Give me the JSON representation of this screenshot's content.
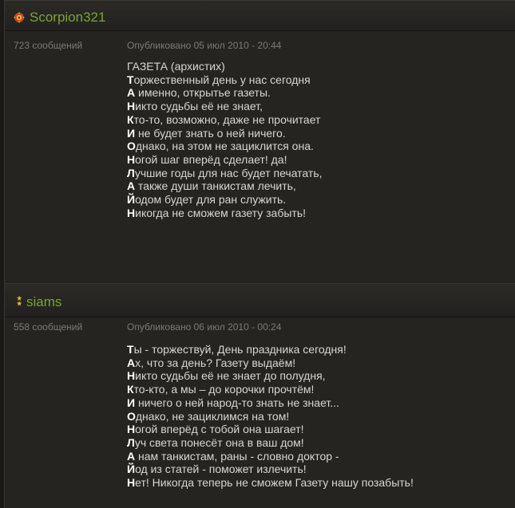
{
  "posts": [
    {
      "author": "Scorpion321",
      "message_count": "723 сообщений",
      "published": "Опубликовано 05 июл 2010 - 20:44",
      "icon": "gear-flower-icon",
      "lines": [
        {
          "cap": "",
          "rest": "ГАЗЕТА (архистих)"
        },
        {
          "cap": "Т",
          "rest": "оржественный день у нас сегодня"
        },
        {
          "cap": "А",
          "rest": " именно, открытье газеты."
        },
        {
          "cap": "Н",
          "rest": "икто судьбы её не знает,"
        },
        {
          "cap": "К",
          "rest": "то-то, возможно, даже не прочитает"
        },
        {
          "cap": "И",
          "rest": " не будет знать о ней ничего."
        },
        {
          "cap": "О",
          "rest": "днако, на этом не зациклится она."
        },
        {
          "cap": "Н",
          "rest": "огой шаг вперёд сделает! да!"
        },
        {
          "cap": "Л",
          "rest": "учшие годы для нас будет печатать,"
        },
        {
          "cap": "А",
          "rest": " также души танкистам лечить,"
        },
        {
          "cap": "Й",
          "rest": "одом будет для ран служить."
        },
        {
          "cap": "Н",
          "rest": "икогда не сможем газету забыть!"
        }
      ]
    },
    {
      "author": "siams",
      "message_count": "558 сообщений",
      "published": "Опубликовано 06 июл 2010 - 00:24",
      "icon": "rank-star-icon",
      "lines": [
        {
          "cap": "Т",
          "rest": "ы - торжествуй, День праздника сегодня!"
        },
        {
          "cap": "А",
          "rest": "х, что за день? Газету выдаём!"
        },
        {
          "cap": "Н",
          "rest": "икто судьбы её не знает до полудня,"
        },
        {
          "cap": "К",
          "rest": "то-кто, а мы – до корочки прочтём!"
        },
        {
          "cap": "И",
          "rest": " ничего о ней народ-то знать не знает..."
        },
        {
          "cap": "О",
          "rest": "днако, не зациклимся на том!"
        },
        {
          "cap": "Н",
          "rest": "огой вперёд с тобой она шагает!"
        },
        {
          "cap": "Л",
          "rest": "уч света понесёт она в ваш дом!"
        },
        {
          "cap": "А",
          "rest": " нам танкистам, раны - словно доктор -"
        },
        {
          "cap": "Й",
          "rest": "од из статей - поможет излечить!"
        },
        {
          "cap": "Н",
          "rest": "ет! Никогда теперь не сможем Газету нашу позабыть!"
        }
      ]
    }
  ],
  "colors": {
    "author": "#7aa23a",
    "meta": "#7d7a74",
    "text": "#d8d6d1",
    "background": "#262421"
  }
}
